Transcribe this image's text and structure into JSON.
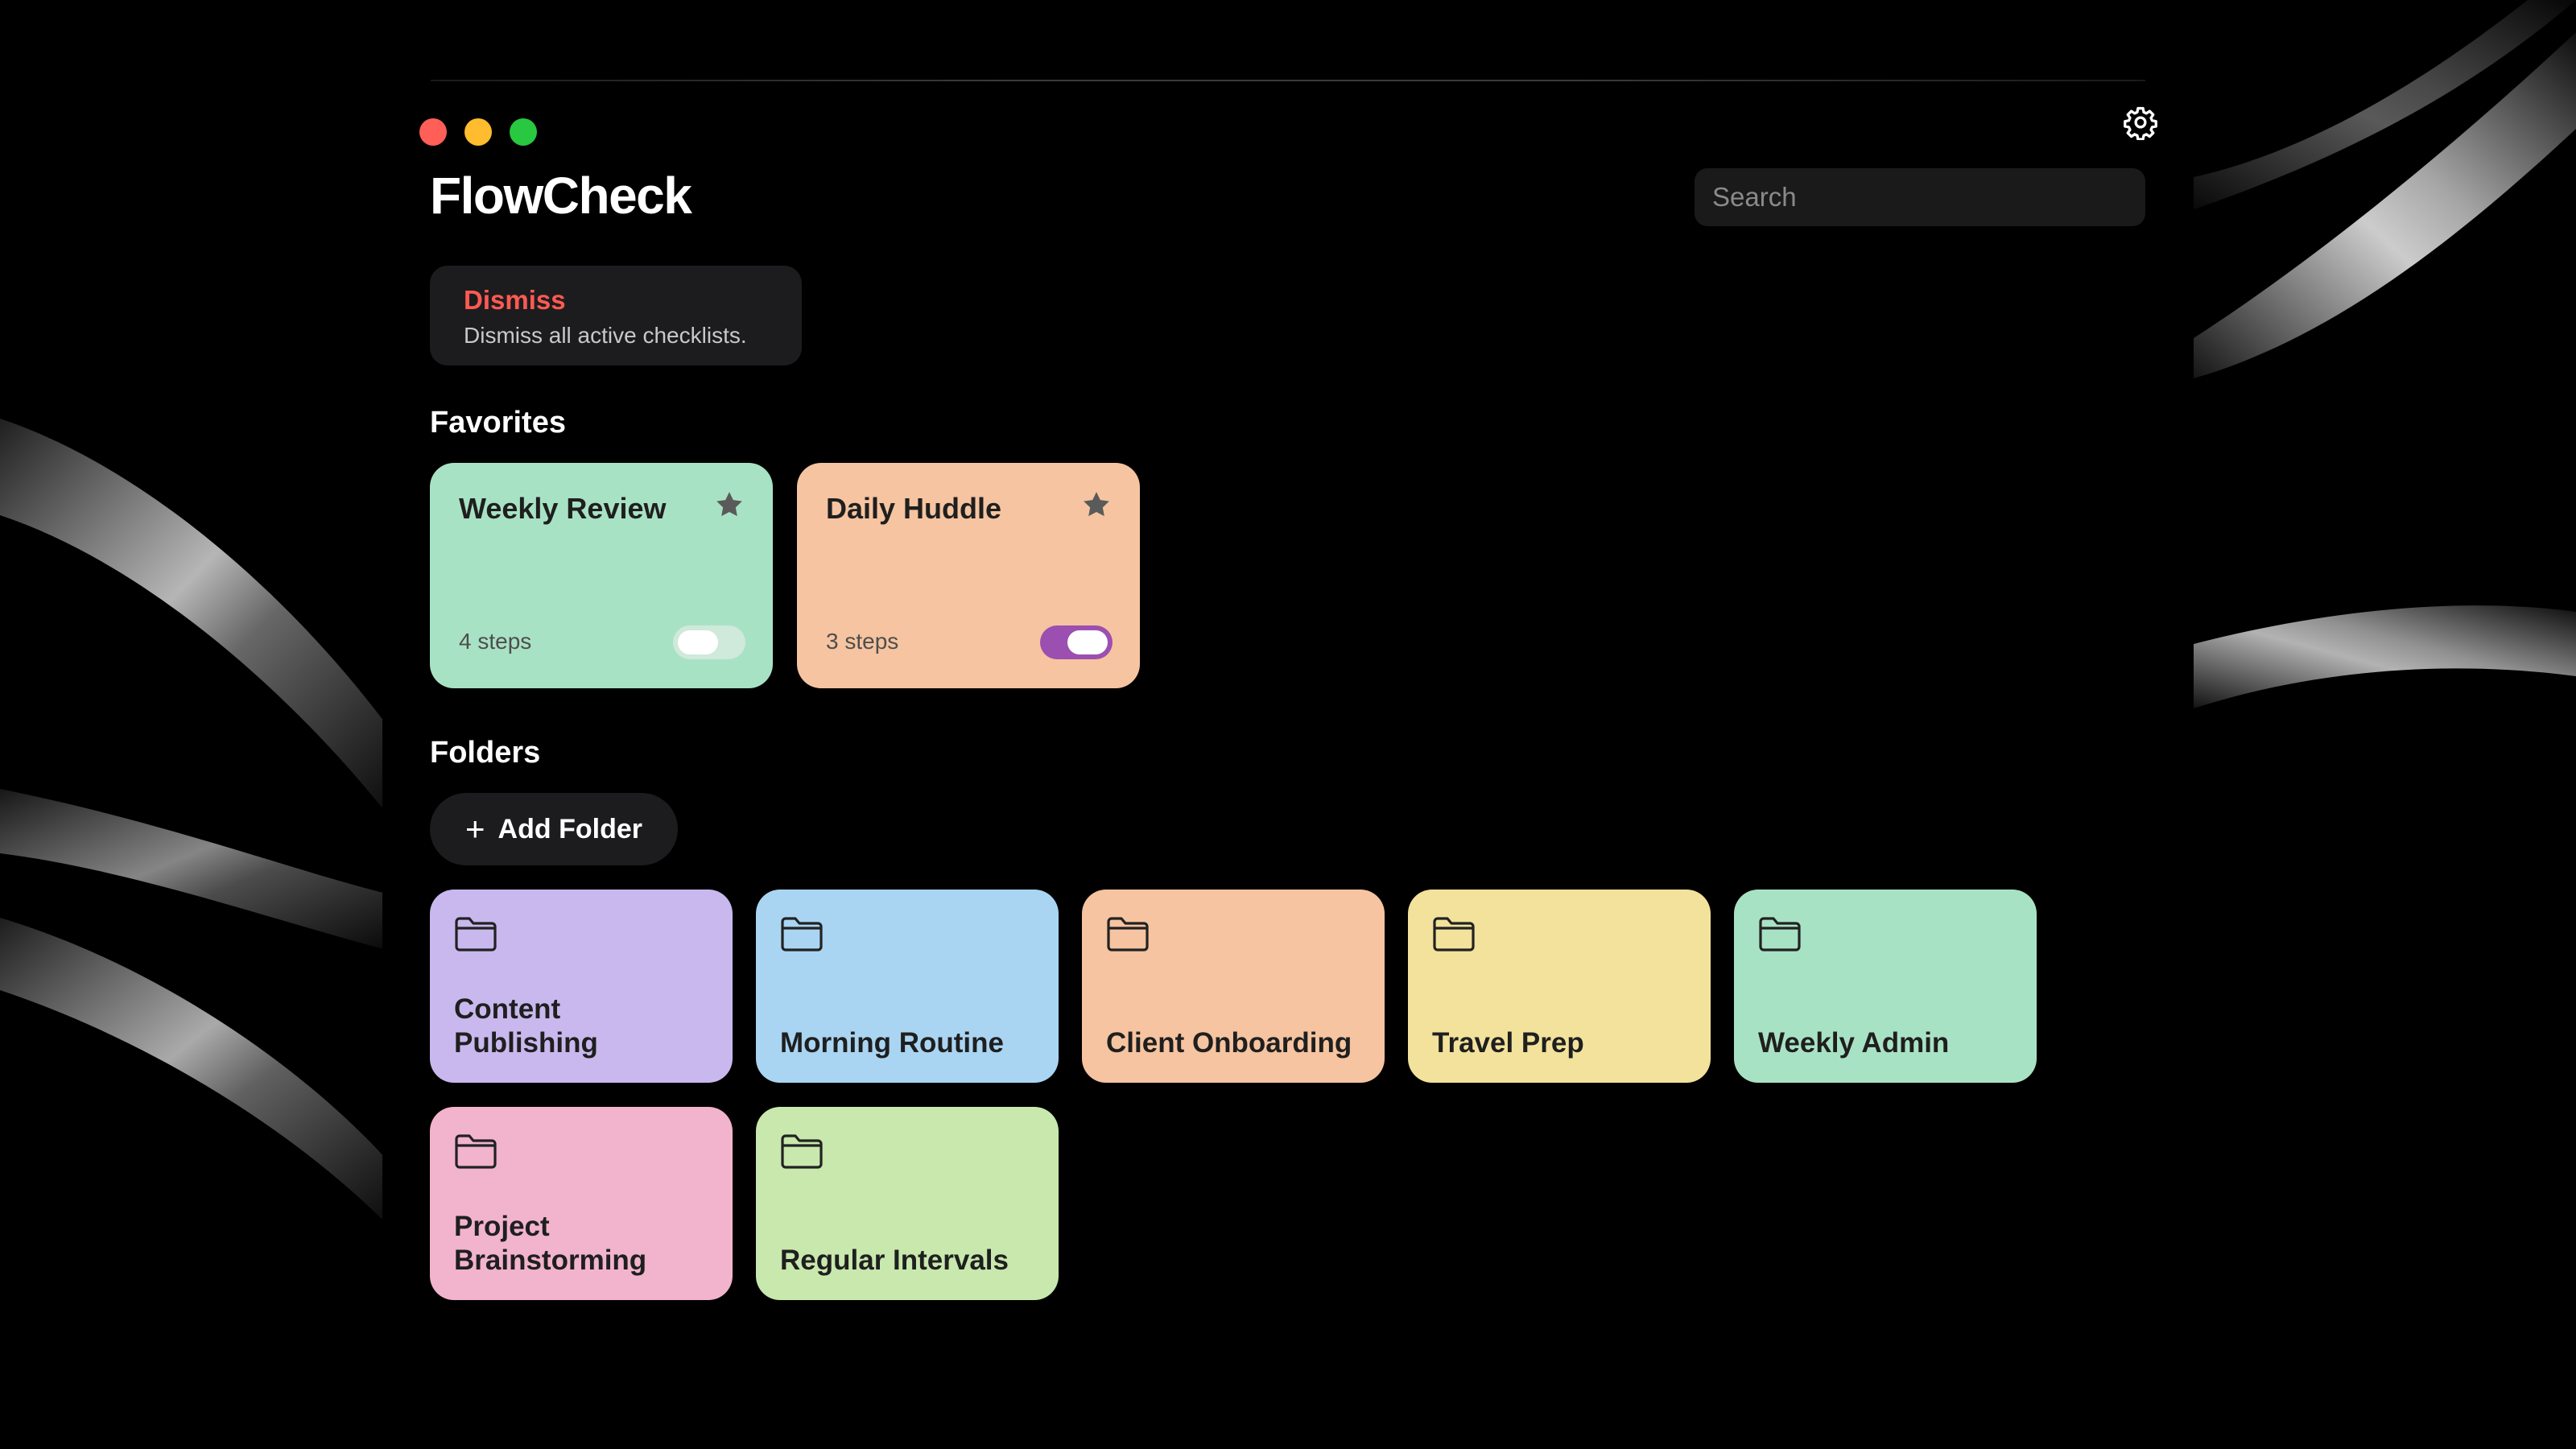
{
  "app": {
    "title": "FlowCheck"
  },
  "search": {
    "placeholder": "Search"
  },
  "dismiss": {
    "title": "Dismiss",
    "description": "Dismiss all active checklists."
  },
  "sections": {
    "favorites": "Favorites",
    "folders": "Folders"
  },
  "favorites": [
    {
      "title": "Weekly Review",
      "steps": "4 steps",
      "starred": true,
      "toggle_on": false,
      "color": "#a8e2c4"
    },
    {
      "title": "Daily Huddle",
      "steps": "3 steps",
      "starred": true,
      "toggle_on": true,
      "color": "#f6c4a0"
    }
  ],
  "add_folder": {
    "label": "Add Folder",
    "icon": "plus-icon"
  },
  "folders": [
    {
      "label": "Content\nPublishing",
      "color": "#c9b8ee",
      "icon": "folder-icon"
    },
    {
      "label": "Morning Routine",
      "color": "#a9d5f2",
      "icon": "folder-icon"
    },
    {
      "label": "Client Onboarding",
      "color": "#f6c4a0",
      "icon": "folder-icon"
    },
    {
      "label": "Travel Prep",
      "color": "#f3e29b",
      "icon": "folder-icon"
    },
    {
      "label": "Weekly Admin",
      "color": "#a8e2c4",
      "icon": "folder-icon"
    },
    {
      "label": "Project\nBrainstorming",
      "color": "#f2b3cc",
      "icon": "folder-icon"
    },
    {
      "label": "Regular Intervals",
      "color": "#c8e8ad",
      "icon": "folder-icon"
    }
  ],
  "colors": {
    "accent_toggle": "#9b4fb0",
    "toggle_off": "#cfe9da",
    "dismiss_red": "#ff5a52"
  },
  "icons": {
    "settings": "gear-icon",
    "star": "star-icon"
  }
}
